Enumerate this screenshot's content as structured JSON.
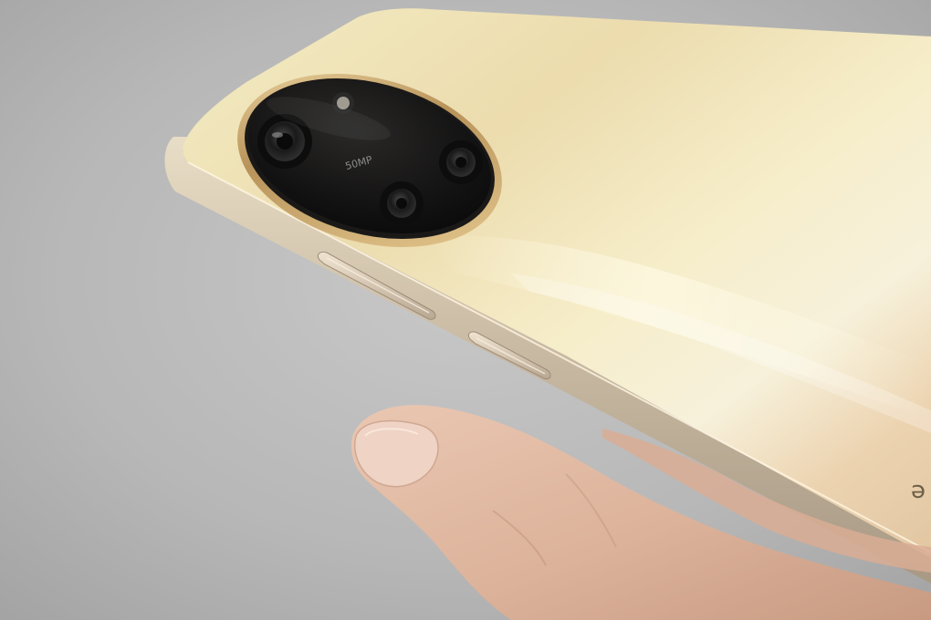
{
  "photo": {
    "subject": "smartphone-rear-in-hand",
    "camera_badge": "50MP",
    "back_text_fragment": "e",
    "colors": {
      "background": "#b7b7b7",
      "phone_body": "#ecdcae",
      "phone_frame": "#cdbfa8",
      "camera_glass": "#151414",
      "camera_ring": "#cfae72",
      "skin": "#e2b9a2"
    }
  }
}
